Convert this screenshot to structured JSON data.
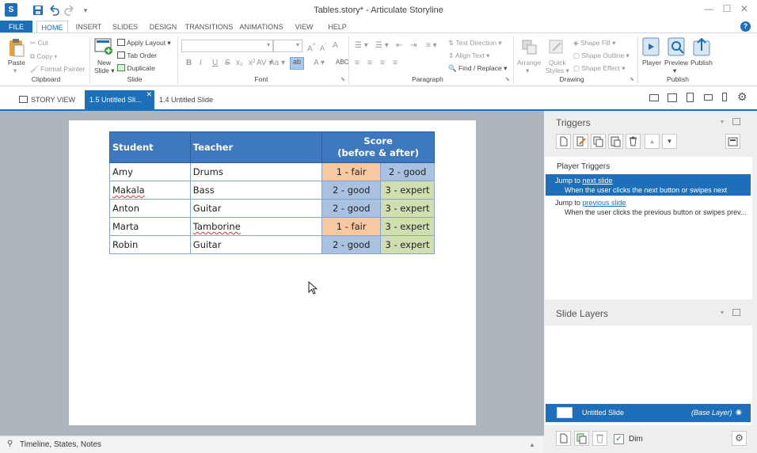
{
  "window": {
    "title": "Tables.story* - Articulate Storyline"
  },
  "menu": {
    "file": "FILE",
    "home": "HOME",
    "insert": "INSERT",
    "slides": "SLIDES",
    "design": "DESIGN",
    "transitions": "TRANSITIONS",
    "animations": "ANIMATIONS",
    "view": "VIEW",
    "help": "HELP"
  },
  "ribbon": {
    "clipboard": {
      "paste": "Paste",
      "cut": "Cut",
      "copy": "Copy",
      "format_painter": "Format Painter",
      "group": "Clipboard"
    },
    "slide": {
      "new_slide": "New",
      "new_slide2": "Slide",
      "apply_layout": "Apply Layout",
      "tab_order": "Tab Order",
      "duplicate": "Duplicate",
      "group": "Slide"
    },
    "font": {
      "group": "Font"
    },
    "paragraph": {
      "text_direction": "Text Direction",
      "align_text": "Align Text",
      "find_replace": "Find / Replace",
      "group": "Paragraph"
    },
    "drawing": {
      "arrange": "Arrange",
      "quick_styles": "Quick",
      "quick_styles2": "Styles",
      "shape_fill": "Shape Fill",
      "shape_outline": "Shape Outline",
      "shape_effect": "Shape Effect",
      "group": "Drawing"
    },
    "publish": {
      "player": "Player",
      "preview": "Preview",
      "publish": "Publish",
      "group": "Publish"
    }
  },
  "tabs": {
    "story_view": "STORY VIEW",
    "active": "1.5 Untitled Sli...",
    "other": "1.4 Untitled Slide"
  },
  "table": {
    "headers": [
      "Student",
      "Teacher",
      "Score",
      "(before & after)"
    ],
    "rows": [
      {
        "student": "Amy",
        "teacher": "Drums",
        "before": "1 - fair",
        "after": "2 - good"
      },
      {
        "student": "Makala",
        "teacher": "Bass",
        "before": "2 - good",
        "after": "3 - expert"
      },
      {
        "student": "Anton",
        "teacher": "Guitar",
        "before": "2 - good",
        "after": "3 - expert"
      },
      {
        "student": "Marta",
        "teacher": "Tamborine",
        "before": "1 - fair",
        "after": "3 - expert"
      },
      {
        "student": "Robin",
        "teacher": "Guitar",
        "before": "2 - good",
        "after": "3 - expert"
      }
    ]
  },
  "status": {
    "text": "Timeline, States, Notes"
  },
  "triggers": {
    "title": "Triggers",
    "section": "Player Triggers",
    "items": [
      {
        "action": "Jump to",
        "target": "next slide",
        "condition": "When the user clicks the next button or swipes next"
      },
      {
        "action": "Jump to",
        "target": "previous slide",
        "condition": "When the user clicks the previous button or swipes prev..."
      }
    ]
  },
  "layers": {
    "title": "Slide Layers",
    "base_name": "Untitled Slide",
    "base_tag": "(Base Layer)",
    "dim": "Dim"
  },
  "colors": {
    "accent": "#1e6fba",
    "header": "#3e78bf",
    "fair": "#f8c9a0",
    "good": "#a9c2e2",
    "expert": "#cfdfb1"
  }
}
